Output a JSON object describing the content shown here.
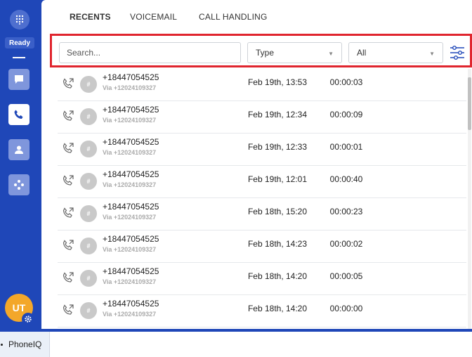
{
  "sidebar": {
    "status": "Ready",
    "avatar_initials": "UT",
    "icons": [
      "dialpad-icon",
      "chat-icon",
      "phone-icon",
      "contact-icon",
      "integrations-icon",
      "gear-icon"
    ],
    "accent_color": "#1f47b8",
    "avatar_color": "#f3a72a"
  },
  "tabs": [
    {
      "label": "RECENTS",
      "active": true
    },
    {
      "label": "VOICEMAIL",
      "active": false
    },
    {
      "label": "CALL HANDLING",
      "active": false
    }
  ],
  "filters": {
    "search_placeholder": "Search...",
    "type_value": "Type",
    "scope_value": "All"
  },
  "calls": [
    {
      "number": "+18447054525",
      "via": "Via +12024109327",
      "date": "Feb 19th, 13:53",
      "duration": "00:00:03"
    },
    {
      "number": "+18447054525",
      "via": "Via +12024109327",
      "date": "Feb 19th, 12:34",
      "duration": "00:00:09"
    },
    {
      "number": "+18447054525",
      "via": "Via +12024109327",
      "date": "Feb 19th, 12:33",
      "duration": "00:00:01"
    },
    {
      "number": "+18447054525",
      "via": "Via +12024109327",
      "date": "Feb 19th, 12:01",
      "duration": "00:00:40"
    },
    {
      "number": "+18447054525",
      "via": "Via +12024109327",
      "date": "Feb 18th, 15:20",
      "duration": "00:00:23"
    },
    {
      "number": "+18447054525",
      "via": "Via +12024109327",
      "date": "Feb 18th, 14:23",
      "duration": "00:00:02"
    },
    {
      "number": "+18447054525",
      "via": "Via +12024109327",
      "date": "Feb 18th, 14:20",
      "duration": "00:00:05"
    },
    {
      "number": "+18447054525",
      "via": "Via +12024109327",
      "date": "Feb 18th, 14:20",
      "duration": "00:00:00"
    }
  ],
  "avatar_glyph": "#",
  "taskbar": {
    "app_label": "PhoneIQ"
  }
}
